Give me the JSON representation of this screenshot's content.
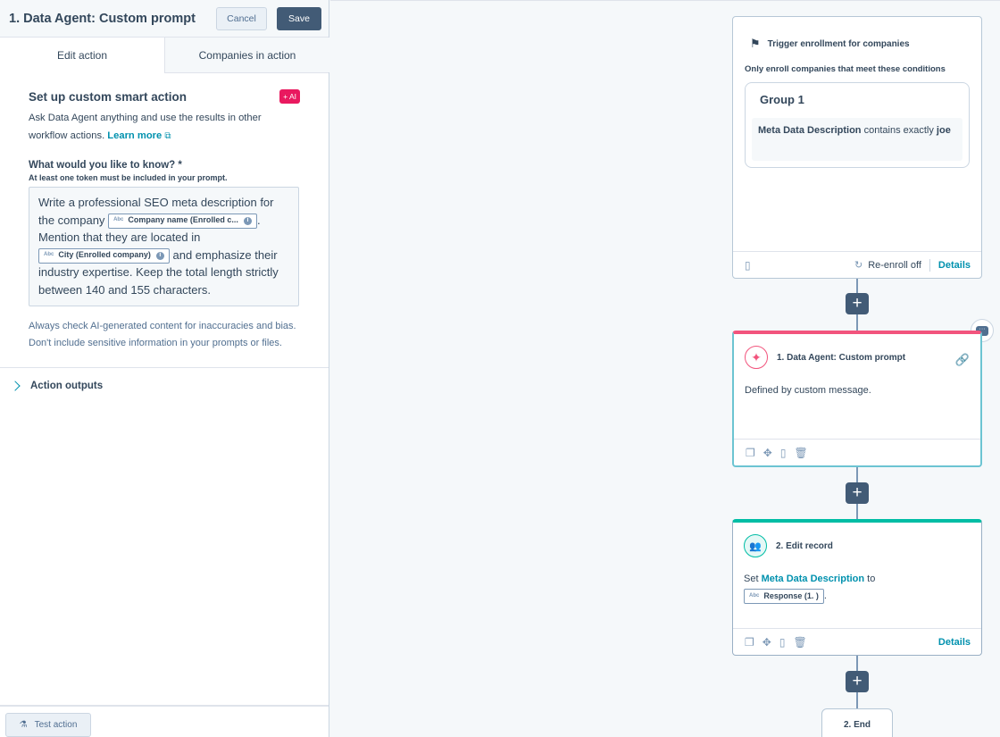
{
  "panel": {
    "title": "1. Data Agent: Custom prompt",
    "cancel_label": "Cancel",
    "save_label": "Save",
    "tabs": [
      {
        "label": "Edit action"
      },
      {
        "label": "Companies in action"
      }
    ],
    "setup_title": "Set up custom smart action",
    "ai_badge": "+ AI",
    "description": "Ask Data Agent anything and use the results in other workflow actions.",
    "learn_more": "Learn more",
    "question_label": "What would you like to know? *",
    "question_sub": "At least one token must be included in your prompt.",
    "prompt": {
      "part1": "Write a professional SEO meta description for the company",
      "token1": "Company name (Enrolled c...",
      "part2": ". Mention that they are located in",
      "token2": "City (Enrolled company)",
      "part3": "and emphasize their industry expertise. Keep the total length strictly between 140 and 155 characters."
    },
    "token_prefix": "Abc",
    "disclaimer": "Always check AI-generated content for inaccuracies and bias. Don't include sensitive information in your prompts or files.",
    "outputs_label": "Action outputs",
    "test_action_label": "Test action"
  },
  "canvas": {
    "trigger": {
      "heading": "Trigger enrollment for companies",
      "subheading": "Only enroll companies that meet these conditions",
      "group_title": "Group 1",
      "condition_property": "Meta Data Description",
      "condition_operator": "contains exactly",
      "condition_value": "joe",
      "reenroll": "Re-enroll off",
      "details": "Details"
    },
    "action1": {
      "title": "1. Data Agent: Custom prompt",
      "body": "Defined by custom message."
    },
    "action2": {
      "title": "2. Edit record",
      "set_word": "Set",
      "property": "Meta Data Description",
      "to_word": "to",
      "token": "Response (1. )",
      "details": "Details"
    },
    "end_label": "2. End",
    "plus_label": "+"
  },
  "colors": {
    "primary": "#425b76",
    "link": "#0091ae",
    "ai_accent": "#f2547d",
    "ai_badge": "#e9195f",
    "edit_accent": "#00bda5",
    "selected_border": "#6cc4d2"
  },
  "icons": [
    "flag-icon",
    "clipboard-icon",
    "refresh-icon",
    "ai-sparkle-icon",
    "link-icon",
    "copy-icon",
    "move-icon",
    "delete-icon",
    "comment-icon",
    "people-icon",
    "flask-icon",
    "external-link-icon",
    "chevron-right-icon",
    "info-icon"
  ]
}
